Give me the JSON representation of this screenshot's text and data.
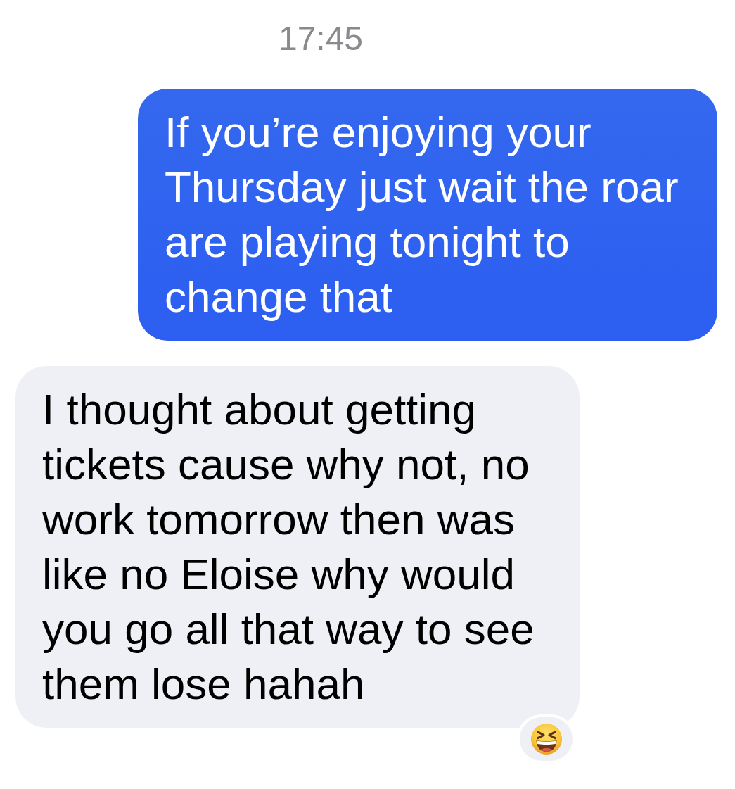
{
  "timestamp": "17:45",
  "messages": [
    {
      "kind": "sent",
      "text": "If you’re enjoying your Thursday just wait the roar are playing tonight to change that",
      "reacted": false
    },
    {
      "kind": "received",
      "text": "I thought about getting tickets cause why not, no work tomorrow then was like no Eloise why would you go all that way to see them lose hahah",
      "reacted": true
    }
  ]
}
